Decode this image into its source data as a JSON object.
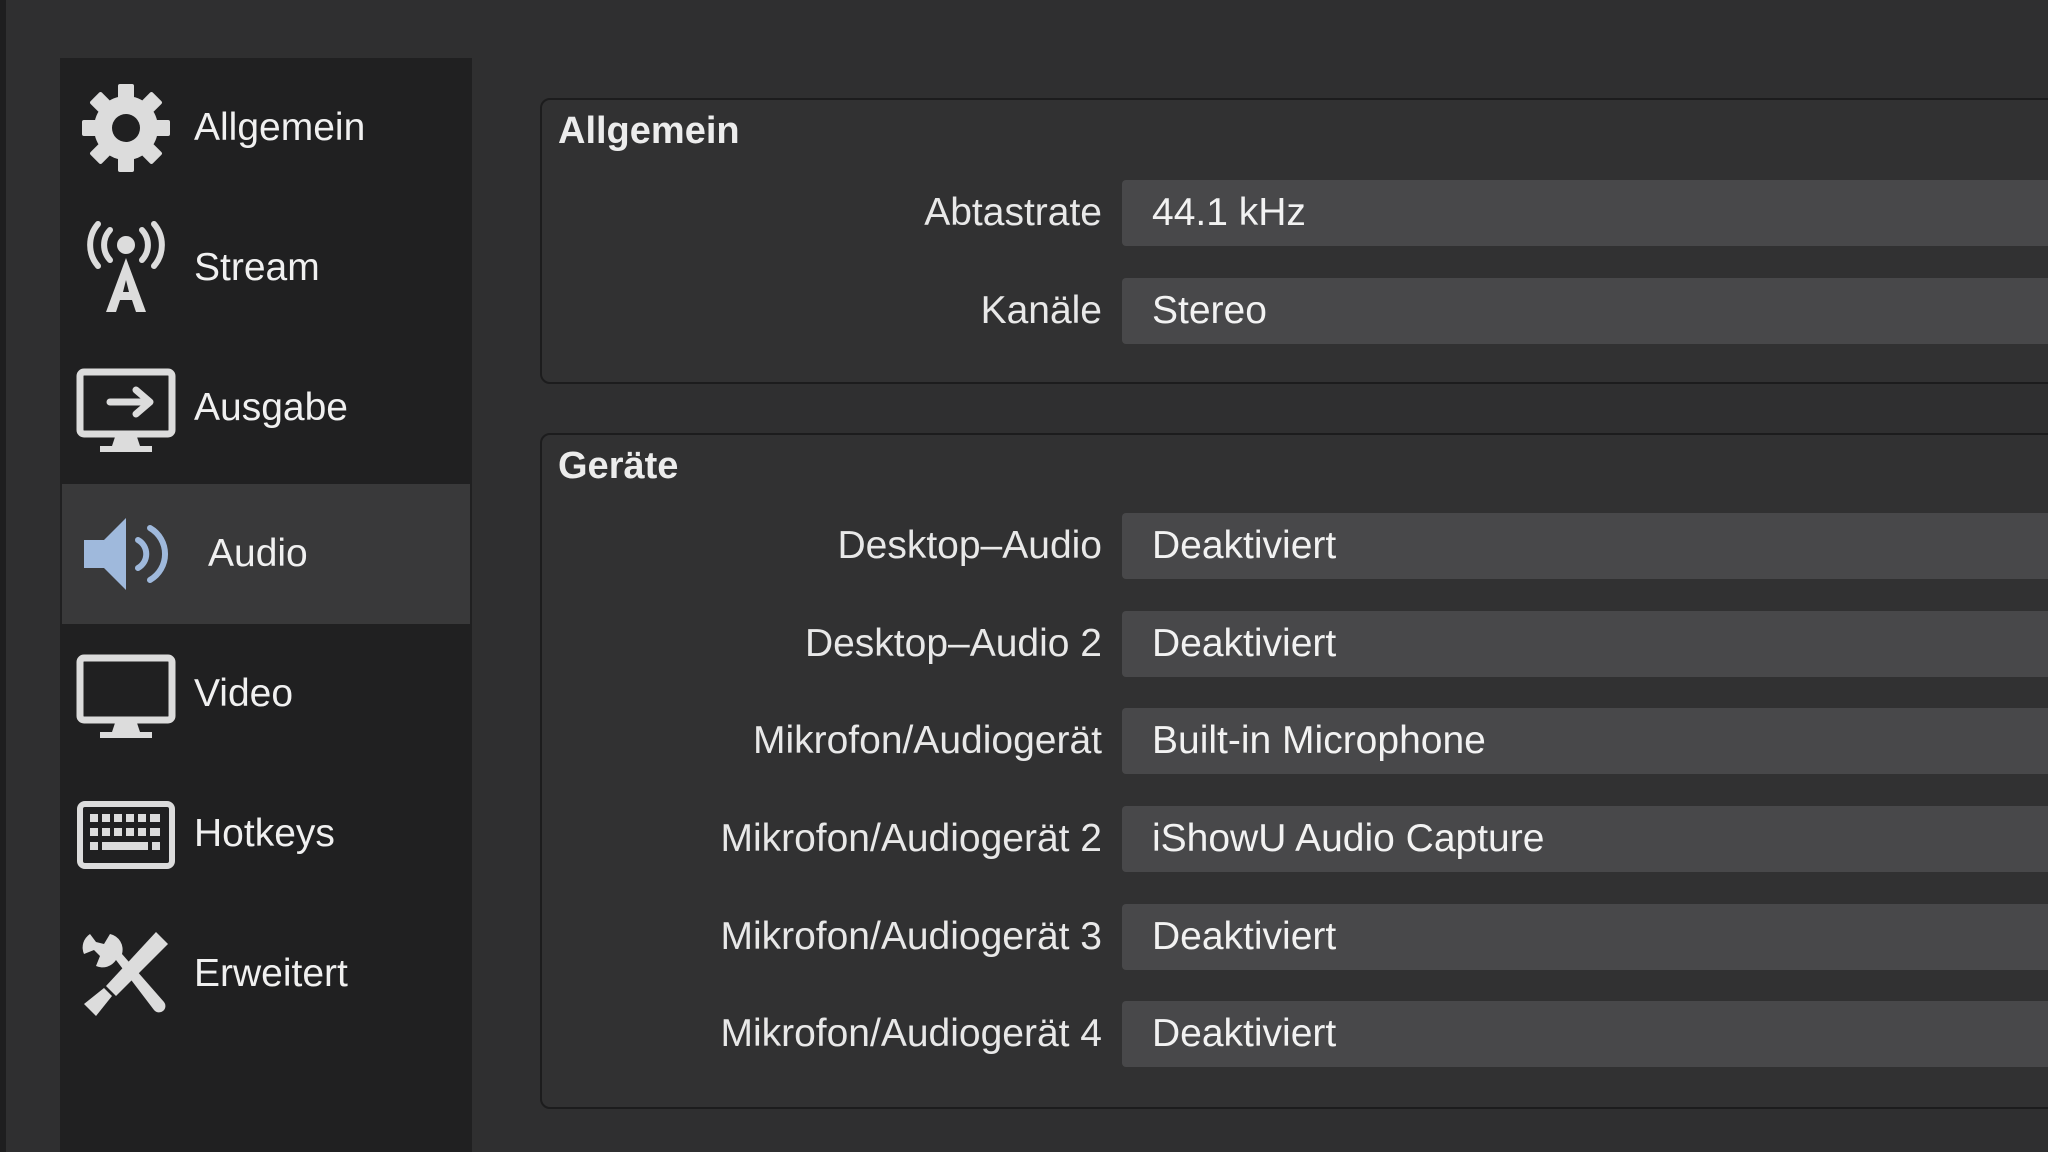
{
  "sidebar": {
    "items": [
      {
        "label": "Allgemein",
        "icon": "gear-icon"
      },
      {
        "label": "Stream",
        "icon": "antenna-icon"
      },
      {
        "label": "Ausgabe",
        "icon": "output-icon"
      },
      {
        "label": "Audio",
        "icon": "speaker-icon",
        "active": true
      },
      {
        "label": "Video",
        "icon": "monitor-icon"
      },
      {
        "label": "Hotkeys",
        "icon": "keyboard-icon"
      },
      {
        "label": "Erweitert",
        "icon": "tools-icon"
      }
    ]
  },
  "general": {
    "title": "Allgemein",
    "sample_rate_label": "Abtastrate",
    "sample_rate_value": "44.1 kHz",
    "channels_label": "Kanäle",
    "channels_value": "Stereo"
  },
  "devices": {
    "title": "Geräte",
    "rows": [
      {
        "label": "Desktop–Audio",
        "value": "Deaktiviert"
      },
      {
        "label": "Desktop–Audio 2",
        "value": "Deaktiviert"
      },
      {
        "label": "Mikrofon/Audiogerät",
        "value": "Built-in Microphone"
      },
      {
        "label": "Mikrofon/Audiogerät 2",
        "value": "iShowU Audio Capture"
      },
      {
        "label": "Mikrofon/Audiogerät 3",
        "value": "Deaktiviert"
      },
      {
        "label": "Mikrofon/Audiogerät 4",
        "value": "Deaktiviert"
      }
    ]
  },
  "colors": {
    "background": "#2f2f30",
    "sidebar": "#202021",
    "active_item": "#39393a",
    "field": "#48484a",
    "speaker_accent": "#9fb9dc"
  }
}
